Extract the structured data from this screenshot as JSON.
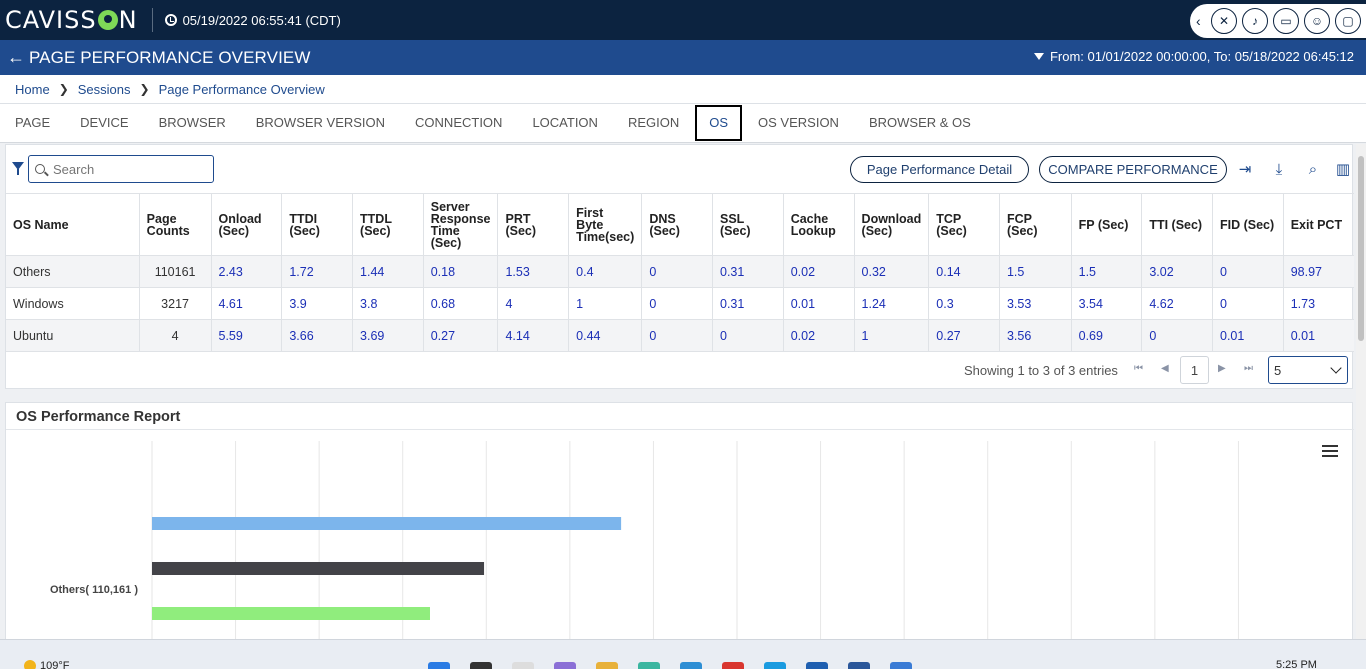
{
  "app": {
    "logo": "CAVISSON",
    "datetime": "05/19/2022 06:55:41 (CDT)",
    "title": "PAGE PERFORMANCE OVERVIEW",
    "date_range": "From: 01/01/2022 00:00:00, To: 05/18/2022 06:45:12"
  },
  "breadcrumb": [
    "Home",
    "Sessions",
    "Page Performance Overview"
  ],
  "tabs": [
    {
      "label": "PAGE",
      "active": false
    },
    {
      "label": "DEVICE",
      "active": false
    },
    {
      "label": "BROWSER",
      "active": false
    },
    {
      "label": "BROWSER VERSION",
      "active": false
    },
    {
      "label": "CONNECTION",
      "active": false
    },
    {
      "label": "LOCATION",
      "active": false
    },
    {
      "label": "REGION",
      "active": false
    },
    {
      "label": "OS",
      "active": true
    },
    {
      "label": "OS VERSION",
      "active": false
    },
    {
      "label": "BROWSER & OS",
      "active": false
    }
  ],
  "toolbar": {
    "search_placeholder": "Search",
    "detail_button": "Page Performance Detail",
    "compare_button": "COMPARE PERFORMANCE",
    "icons": [
      "export-icon",
      "download-icon",
      "find-icon",
      "columns-icon"
    ]
  },
  "table": {
    "columns": [
      "OS Name",
      "Page Counts",
      "Onload (Sec)",
      "TTDI (Sec)",
      "TTDL (Sec)",
      "Server Response Time (Sec)",
      "PRT (Sec)",
      "First Byte Time(sec)",
      "DNS (Sec)",
      "SSL (Sec)",
      "Cache Lookup",
      "Download (Sec)",
      "TCP (Sec)",
      "FCP (Sec)",
      "FP (Sec)",
      "TTI (Sec)",
      "FID (Sec)",
      "Exit PCT"
    ],
    "column_lines": [
      [
        "OS Name"
      ],
      [
        "Page",
        "Counts"
      ],
      [
        "Onload",
        "(Sec)"
      ],
      [
        "TTDI",
        "(Sec)"
      ],
      [
        "TTDL",
        "(Sec)"
      ],
      [
        "Server",
        "Response",
        "Time",
        "(Sec)"
      ],
      [
        "PRT",
        "(Sec)"
      ],
      [
        "First",
        "Byte",
        "Time(sec)"
      ],
      [
        "DNS",
        "(Sec)"
      ],
      [
        "SSL (Sec)"
      ],
      [
        "Cache",
        "Lookup"
      ],
      [
        "Download",
        "(Sec)"
      ],
      [
        "TCP",
        "(Sec)"
      ],
      [
        "FCP",
        "(Sec)"
      ],
      [
        "FP (Sec)"
      ],
      [
        "TTI (Sec)"
      ],
      [
        "FID (Sec)"
      ],
      [
        "Exit PCT"
      ]
    ],
    "rows": [
      [
        "Others",
        "110161",
        "2.43",
        "1.72",
        "1.44",
        "0.18",
        "1.53",
        "0.4",
        "0",
        "0.31",
        "0.02",
        "0.32",
        "0.14",
        "1.5",
        "1.5",
        "3.02",
        "0",
        "98.97"
      ],
      [
        "Windows",
        "3217",
        "4.61",
        "3.9",
        "3.8",
        "0.68",
        "4",
        "1",
        "0",
        "0.31",
        "0.01",
        "1.24",
        "0.3",
        "3.53",
        "3.54",
        "4.62",
        "0",
        "1.73"
      ],
      [
        "Ubuntu",
        "4",
        "5.59",
        "3.66",
        "3.69",
        "0.27",
        "4.14",
        "0.44",
        "0",
        "0",
        "0.02",
        "1",
        "0.27",
        "3.56",
        "0.69",
        "0",
        "0.01",
        "0.01"
      ]
    ]
  },
  "pagination": {
    "info": "Showing 1 to 3 of 3 entries",
    "current_page": "1",
    "page_size": "5"
  },
  "chart_data": {
    "type": "bar",
    "orientation": "horizontal",
    "title": "OS Performance Report",
    "categories": [
      "Others( 110,161 )"
    ],
    "series": [
      {
        "color": "#7cb5ec",
        "values": [
          2.43
        ]
      },
      {
        "color": "#434348",
        "values": [
          1.72
        ]
      },
      {
        "color": "#90ed7d",
        "values": [
          1.44
        ]
      }
    ],
    "xlim": [
      0,
      6
    ],
    "grid": true
  },
  "taskbar": {
    "weather": "109°F",
    "time": "5:25 PM"
  }
}
